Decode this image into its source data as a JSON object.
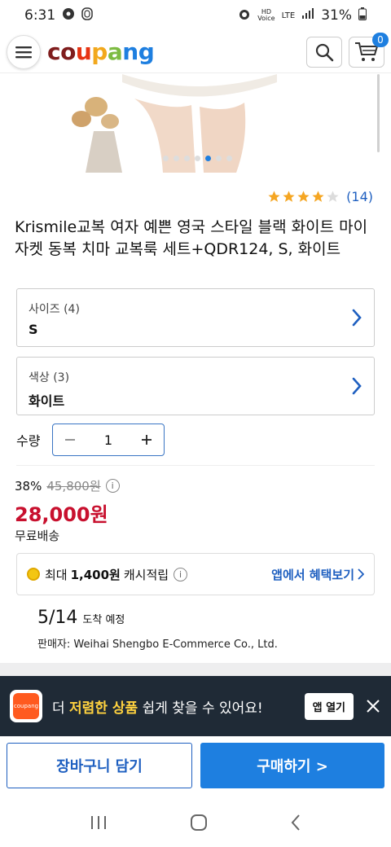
{
  "status_bar": {
    "time": "6:31",
    "battery": "31%",
    "network": "LTE",
    "voice": "HD Voice"
  },
  "header": {
    "logo": [
      "c",
      "o",
      "u",
      "p",
      "a",
      "n",
      "g"
    ],
    "logo_colors": [
      "#7f1d1d",
      "#7f1d1d",
      "#e63312",
      "#f2a81d",
      "#7dbb42",
      "#1e7fe0",
      "#1e7fe0"
    ],
    "cart_count": "0"
  },
  "gallery": {
    "slide_count": 7,
    "active_slide": 4
  },
  "rating": {
    "stars": 4,
    "max": 5,
    "count": "(14)"
  },
  "product": {
    "title": "Krismile교복 여자 예쁜 영국 스타일 블랙 화이트 마이 자켓 동복 치마 교복룩 세트+QDR124, S, 화이트"
  },
  "options": [
    {
      "label": "사이즈 (4)",
      "value": "S"
    },
    {
      "label": "색상 (3)",
      "value": "화이트"
    }
  ],
  "quantity": {
    "label": "수량",
    "value": "1"
  },
  "pricing": {
    "discount": "38%",
    "original": "45,800원",
    "price": "28,000원",
    "shipping": "무료배송"
  },
  "cash": {
    "prefix": "최대",
    "amount": "1,400원",
    "suffix": "캐시적립",
    "link": "앱에서 혜택보기"
  },
  "delivery": {
    "date": "5/14",
    "label": "도착 예정",
    "seller": "판매자: Weihai Shengbo E-Commerce Co., Ltd."
  },
  "banner": {
    "logo_text": "coupang",
    "text_before": "더",
    "highlight": "저렴한 상품",
    "text_after": "쉽게 찾을 수 있어요!",
    "button": "앱 열기"
  },
  "actions": {
    "cart": "장바구니 담기",
    "buy": "구매하기 >"
  },
  "colors": {
    "accent": "#1e7fe0",
    "price_red": "#c8102e",
    "banner_bg": "#1f2a36",
    "banner_highlight": "#ffd23f"
  }
}
